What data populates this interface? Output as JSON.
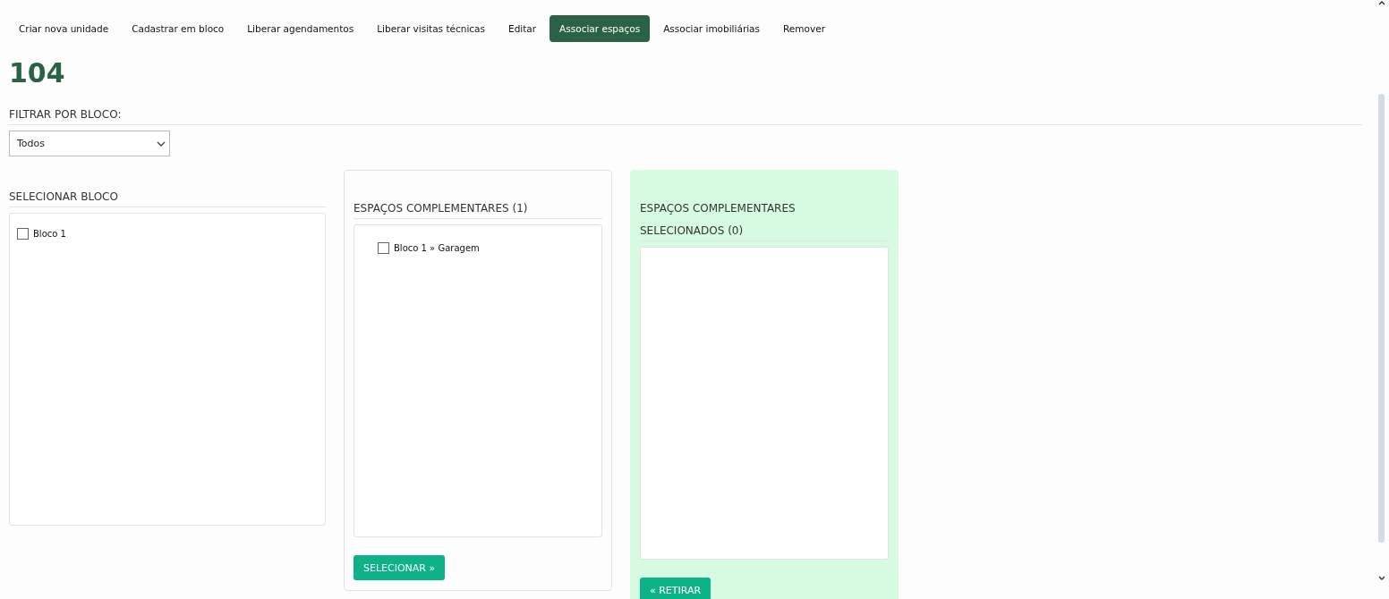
{
  "tabs": [
    {
      "label": "Criar nova unidade",
      "selected": false
    },
    {
      "label": "Cadastrar em bloco",
      "selected": false
    },
    {
      "label": "Liberar agendamentos",
      "selected": false
    },
    {
      "label": "Liberar visitas técnicas",
      "selected": false
    },
    {
      "label": "Editar",
      "selected": false
    },
    {
      "label": "Associar espaços",
      "selected": true
    },
    {
      "label": "Associar imobiliárias",
      "selected": false
    },
    {
      "label": "Remover",
      "selected": false
    }
  ],
  "title": "104",
  "filter": {
    "label": "FILTRAR POR BLOCO:",
    "value": "Todos"
  },
  "blocks_panel": {
    "heading": "SELECIONAR BLOCO",
    "items": [
      {
        "label": "Bloco 1",
        "checked": false
      }
    ]
  },
  "spaces_panel": {
    "heading": "ESPAÇOS COMPLEMENTARES (1)",
    "items": [
      {
        "block": "Bloco 1",
        "separator": "»",
        "name": "Garagem",
        "checked": false
      }
    ],
    "button": "SELECIONAR »"
  },
  "selected_panel": {
    "heading_lines": [
      "ESPAÇOS COMPLEMENTARES",
      "SELECIONADOS (0)"
    ],
    "button": "« RETIRAR"
  }
}
